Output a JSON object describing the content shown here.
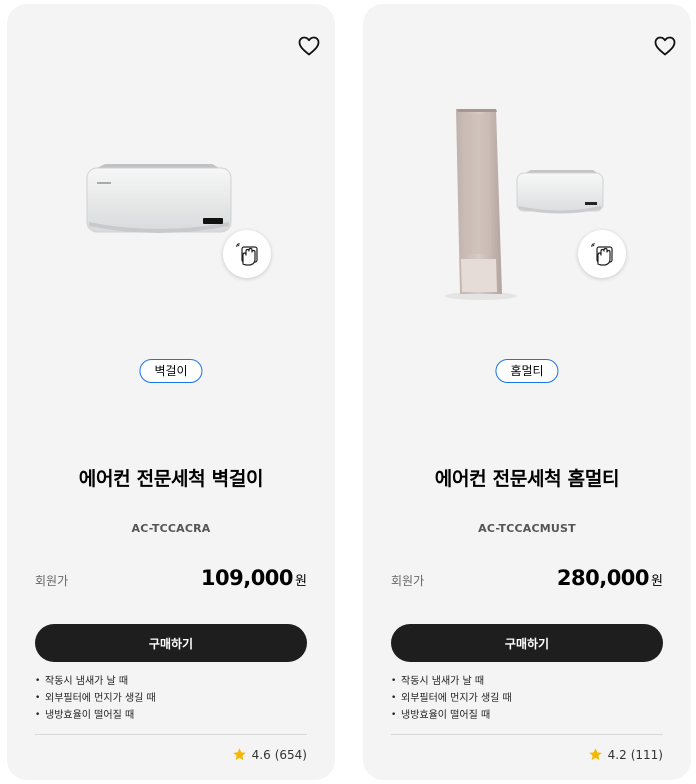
{
  "products": [
    {
      "type_badge": "벽걸이",
      "title": "에어컨 전문세척 벽걸이",
      "model": "AC-TCCACRA",
      "price_label": "회원가",
      "price": "109,000",
      "currency": "원",
      "buy_label": "구매하기",
      "features": [
        "작동시 냄새가 날 때",
        "외부필터에 먼지가 생길 때",
        "냉방효율이 떨어질 때"
      ],
      "rating": "4.6",
      "review_count": "(654)"
    },
    {
      "type_badge": "홈멀티",
      "title": "에어컨 전문세척 홈멀티",
      "model": "AC-TCCACMUST",
      "price_label": "회원가",
      "price": "280,000",
      "currency": "원",
      "buy_label": "구매하기",
      "features": [
        "작동시 냄새가 날 때",
        "외부필터에 먼지가 생길 때",
        "냉방효율이 떨어질 때"
      ],
      "rating": "4.2",
      "review_count": "(111)"
    }
  ],
  "icons": {
    "wishlist": "heart-icon",
    "cleaning": "cleaning-hand-icon",
    "rating": "star-icon"
  },
  "colors": {
    "card_bg": "#f4f4f4",
    "button_bg": "#1e1e1e",
    "badge_border": "#1a73e8",
    "star": "#f5b800"
  }
}
